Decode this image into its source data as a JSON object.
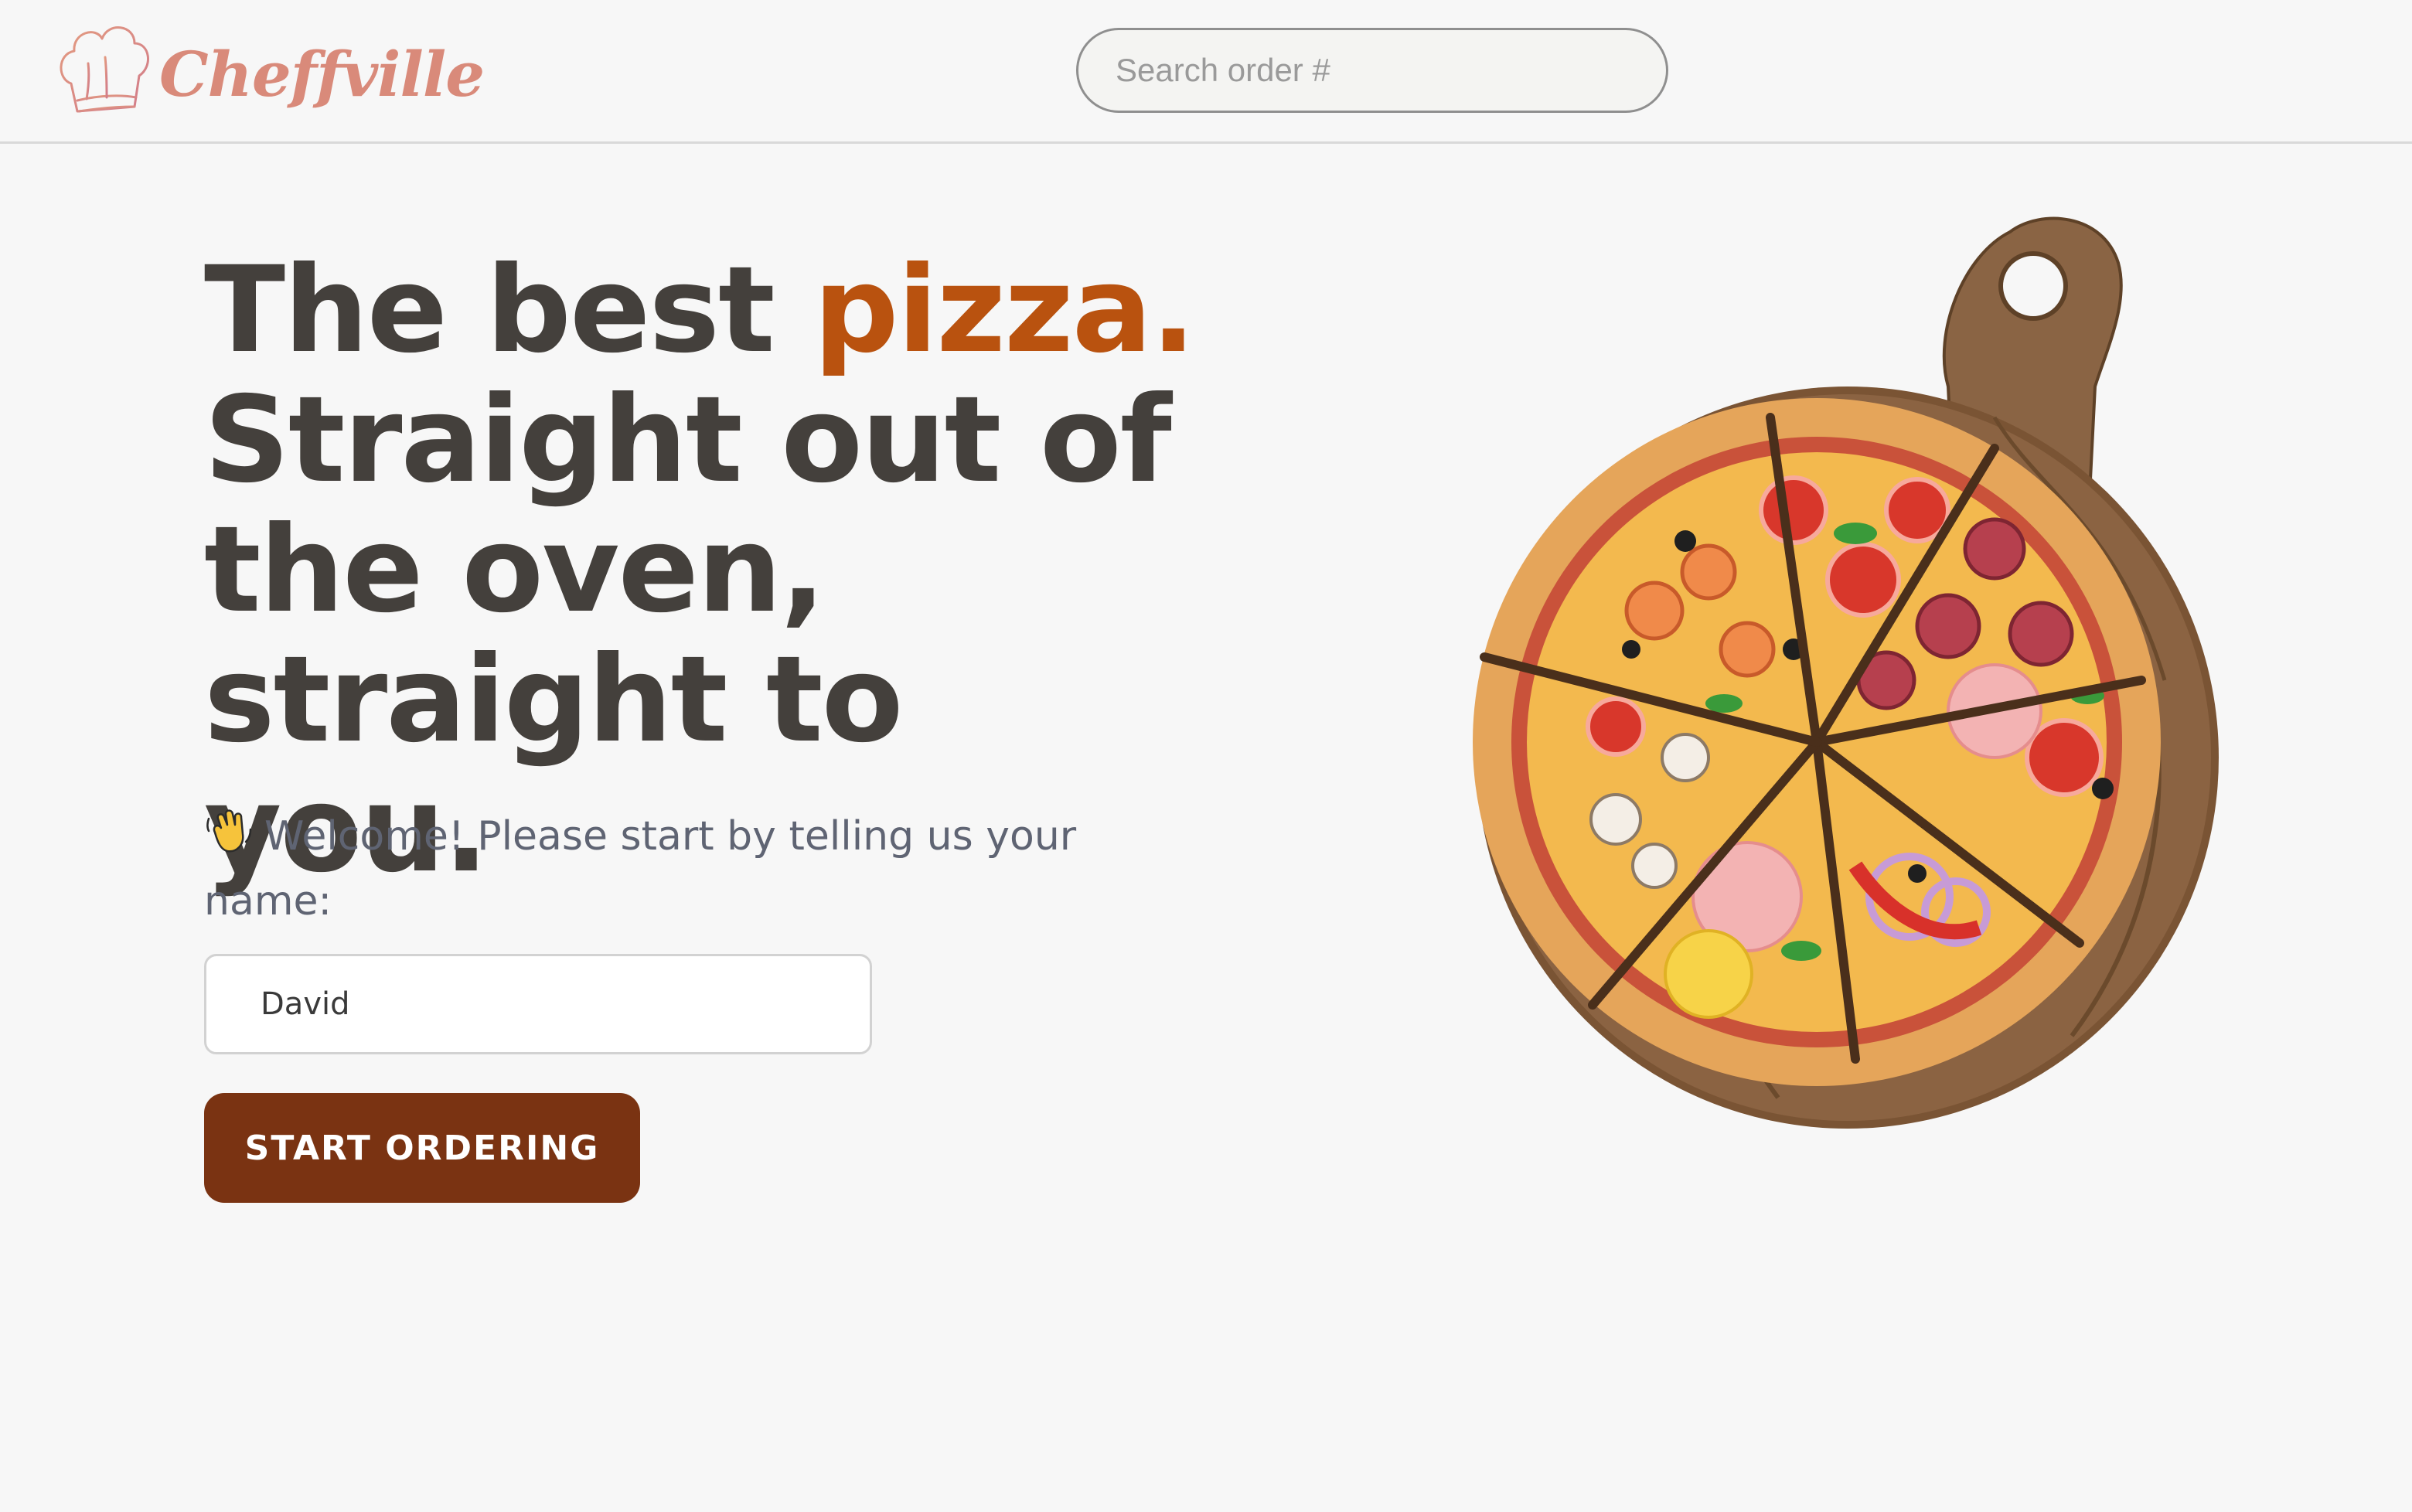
{
  "brand": {
    "name": "Cheffville"
  },
  "search": {
    "placeholder": "Search order #",
    "value": ""
  },
  "hero": {
    "line1_prefix": "The best ",
    "line1_accent": "pizza.",
    "line2": "Straight out of",
    "line3": "the oven,",
    "line4": "straight to you."
  },
  "welcome": {
    "text": "Welcome! Please start by telling us your name:"
  },
  "name_input": {
    "value": "David"
  },
  "start_button": {
    "label": "START ORDERING"
  },
  "colors": {
    "background": "#f7f7f7",
    "heading": "#44403c",
    "accent": "#b9520f",
    "button": "#7a3312",
    "logo": "#d98a7a"
  }
}
